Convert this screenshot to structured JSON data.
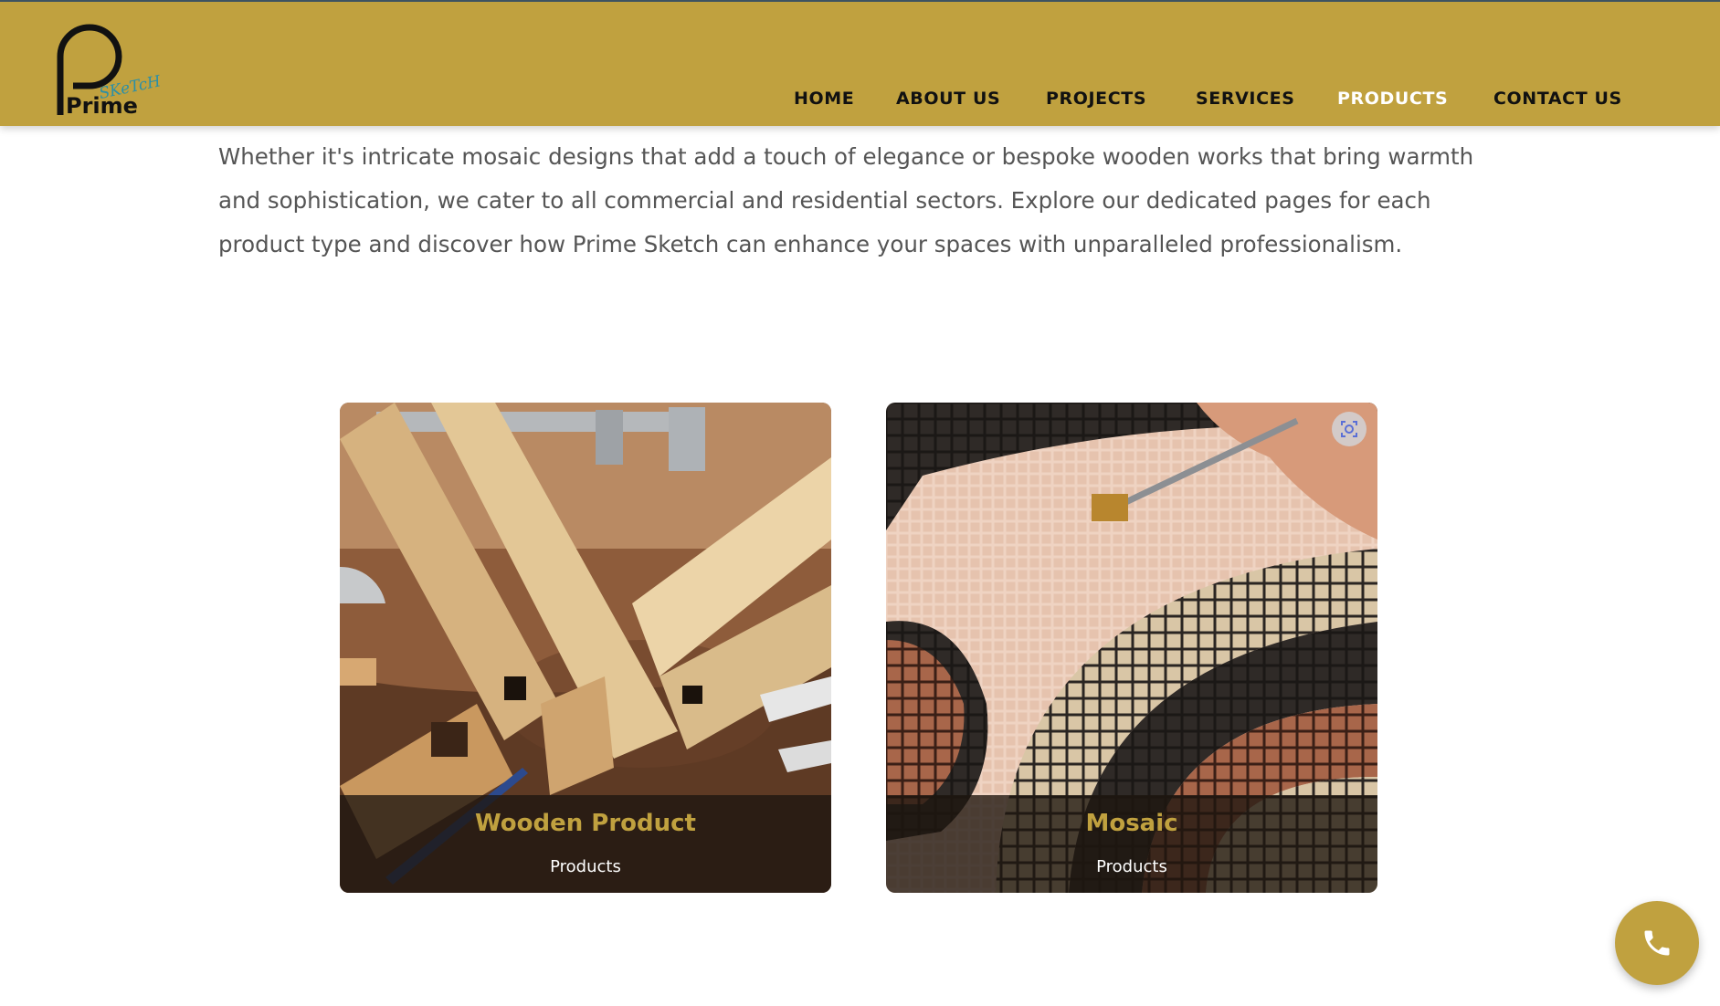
{
  "brand": {
    "logo_word": "Prime",
    "logo_script": "SKeTcH",
    "accent_color": "#c0a13f"
  },
  "nav": {
    "items": [
      {
        "label": "HOME",
        "active": false
      },
      {
        "label": "ABOUT US",
        "active": false
      },
      {
        "label": "PROJECTS",
        "active": false
      },
      {
        "label": "SERVICES",
        "active": false
      },
      {
        "label": "PRODUCTS",
        "active": true
      },
      {
        "label": "CONTACT US",
        "active": false
      }
    ]
  },
  "intro": {
    "lines": [
      "Whether it's intricate mosaic designs that add a touch of elegance or bespoke wooden works that bring warmth",
      "and sophistication, we cater to all commercial and residential sectors. Explore our dedicated pages for each",
      "product type and discover how Prime Sketch can enhance your spaces with unparalleled professionalism."
    ]
  },
  "cards": [
    {
      "title": "Wooden Product",
      "subtitle": "Products",
      "image_icon": "wood-joinery-photo"
    },
    {
      "title": "Mosaic",
      "subtitle": "Products",
      "image_icon": "mosaic-photo"
    }
  ],
  "floating": {
    "icon": "phone-icon"
  }
}
